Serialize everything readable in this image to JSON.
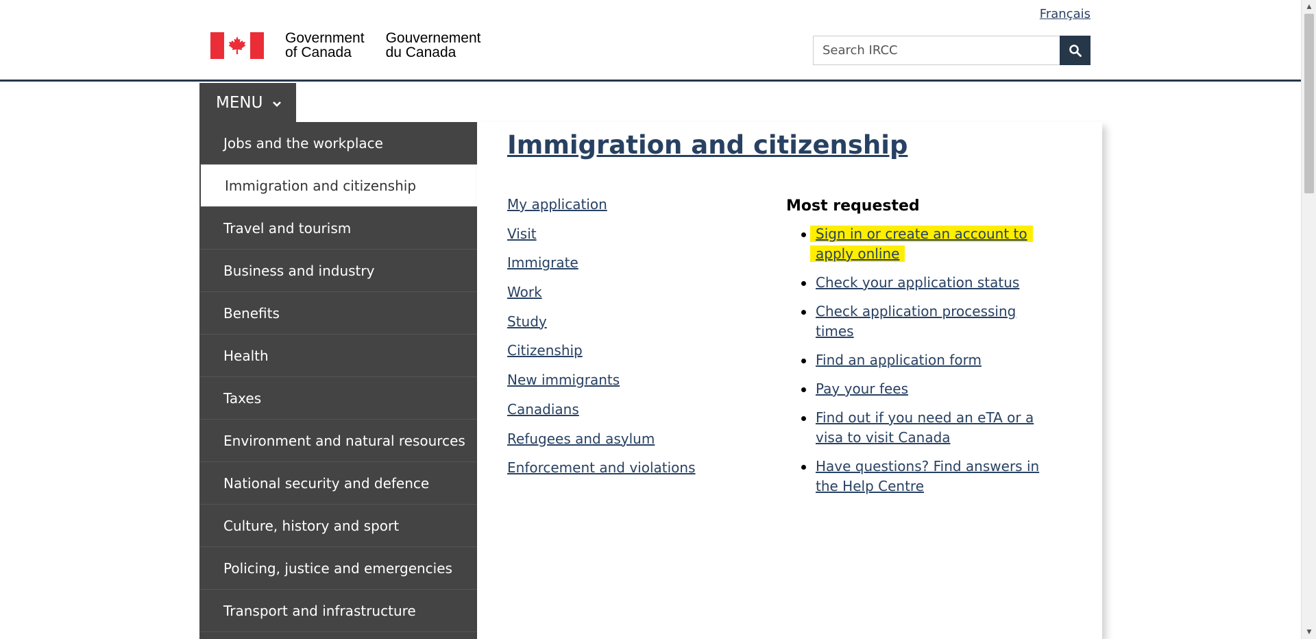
{
  "header": {
    "language_link": "Français",
    "gov_en_line1": "Government",
    "gov_en_line2": "of Canada",
    "gov_fr_line1": "Gouvernement",
    "gov_fr_line2": "du Canada",
    "search_placeholder": "Search IRCC",
    "flag_icon": "canada-flag-icon",
    "search_icon": "search-icon"
  },
  "menu": {
    "label": "MENU",
    "chevron_icon": "chevron-down-icon"
  },
  "sidebar": {
    "items": [
      {
        "label": "Jobs and the workplace",
        "active": false
      },
      {
        "label": "Immigration and citizenship",
        "active": true
      },
      {
        "label": "Travel and tourism",
        "active": false
      },
      {
        "label": "Business and industry",
        "active": false
      },
      {
        "label": "Benefits",
        "active": false
      },
      {
        "label": "Health",
        "active": false
      },
      {
        "label": "Taxes",
        "active": false
      },
      {
        "label": "Environment and natural resources",
        "active": false
      },
      {
        "label": "National security and defence",
        "active": false
      },
      {
        "label": "Culture, history and sport",
        "active": false
      },
      {
        "label": "Policing, justice and emergencies",
        "active": false
      },
      {
        "label": "Transport and infrastructure",
        "active": false
      }
    ]
  },
  "panel": {
    "title": "Immigration and citizenship",
    "links": [
      "My application",
      "Visit",
      "Immigrate",
      "Work",
      "Study",
      "Citizenship",
      "New immigrants",
      "Canadians",
      "Refugees and asylum",
      "Enforcement and violations"
    ],
    "most_requested": {
      "heading": "Most requested",
      "items": [
        {
          "label": "Sign in or create an account to apply online",
          "highlighted": true
        },
        {
          "label": "Check your application status",
          "highlighted": false
        },
        {
          "label": "Check application processing times",
          "highlighted": false
        },
        {
          "label": "Find an application form",
          "highlighted": false
        },
        {
          "label": "Pay your fees",
          "highlighted": false
        },
        {
          "label": "Find out if you need an eTA or a visa to visit Canada",
          "highlighted": false
        },
        {
          "label": "Have questions? Find answers in the Help Centre",
          "highlighted": false
        }
      ]
    }
  },
  "colors": {
    "brand_dark": "#26374a",
    "link": "#284162",
    "menu_bg": "#444444",
    "flag_red": "#eb2d37",
    "highlight": "#ffee00"
  }
}
